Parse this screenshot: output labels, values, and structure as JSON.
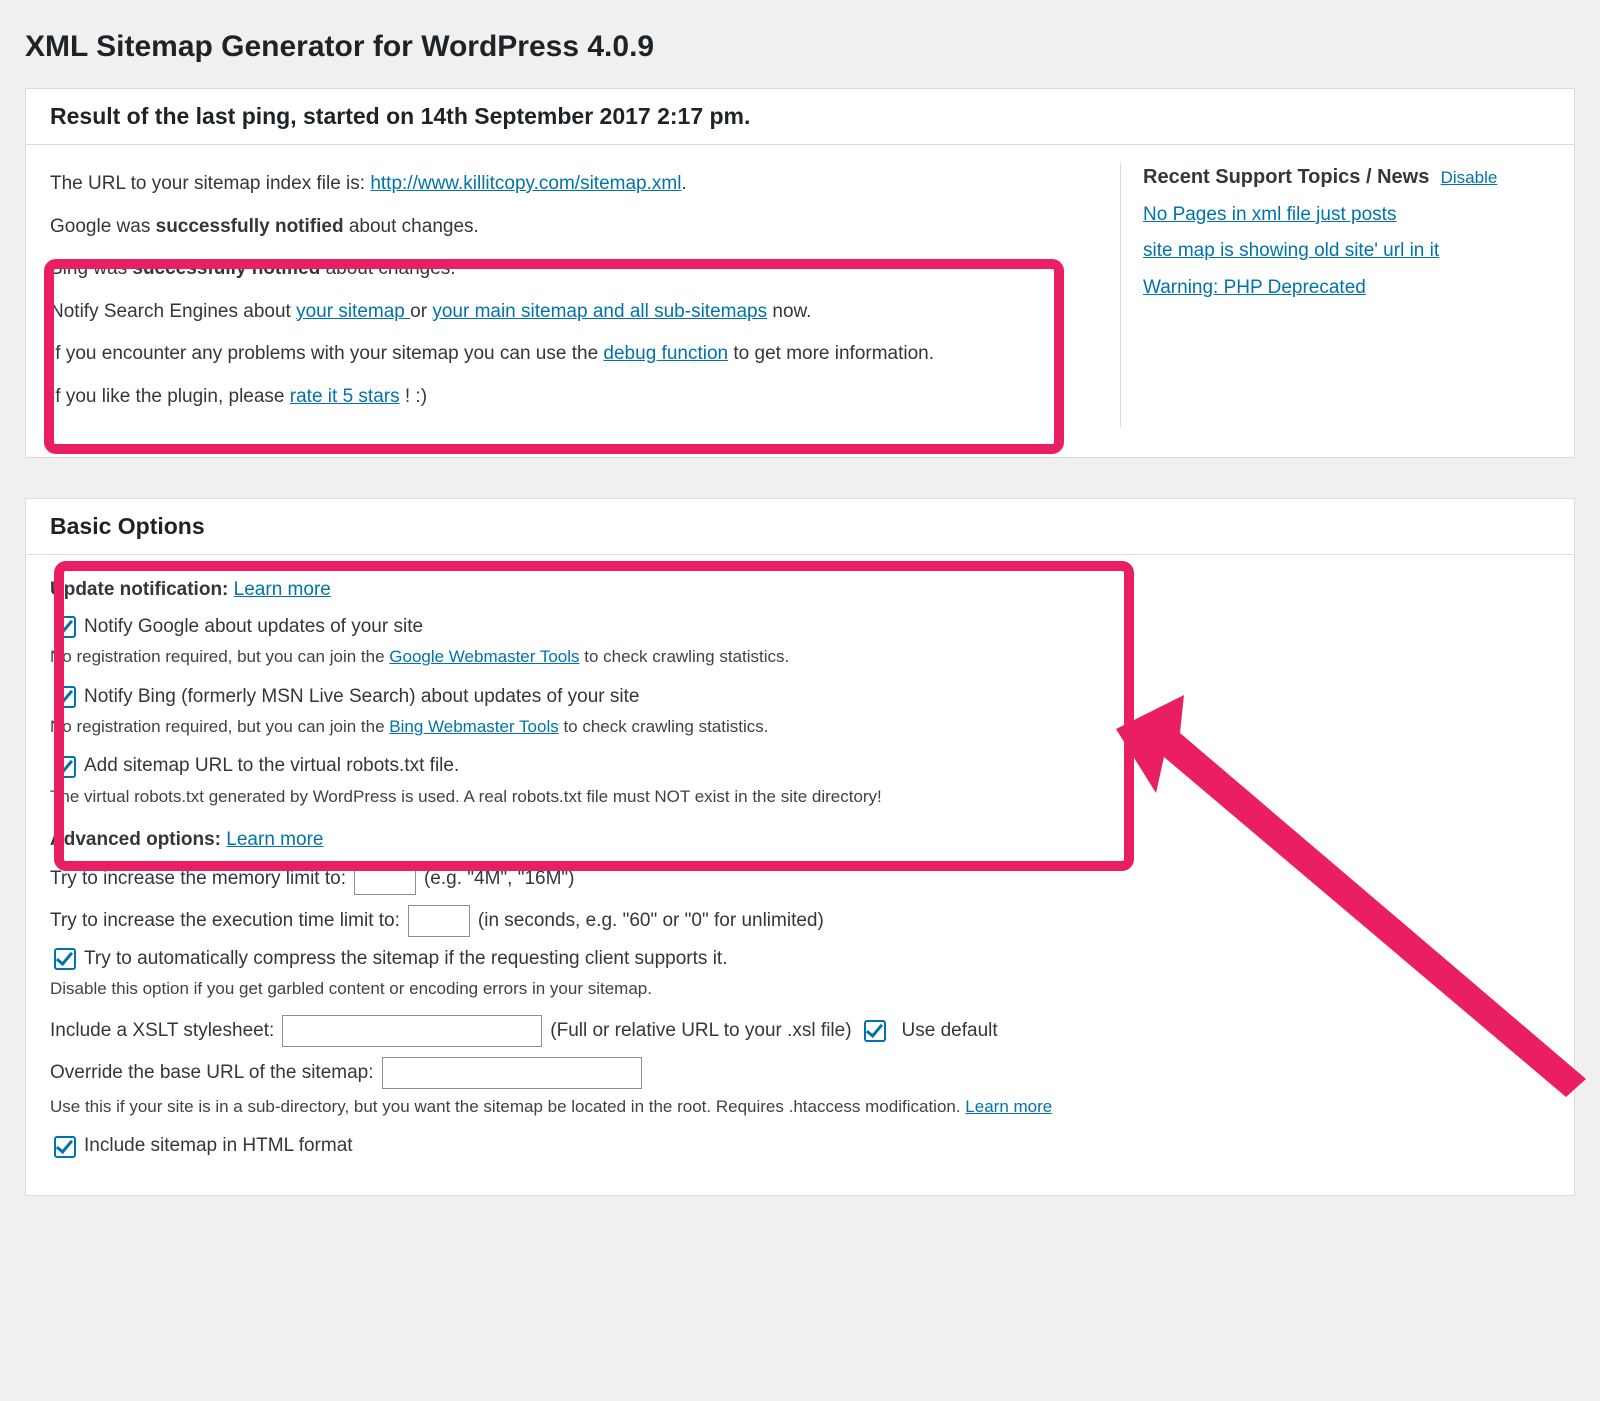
{
  "page": {
    "title": "XML Sitemap Generator for WordPress 4.0.9"
  },
  "ping": {
    "header": "Result of the last ping, started on 14th September 2017 2:17 pm.",
    "intro_prefix": "The URL to your sitemap index file is: ",
    "intro_link": "http://www.killitcopy.com/sitemap.xml",
    "intro_suffix": ".",
    "google_prefix": "Google was ",
    "google_bold": "successfully notified",
    "google_suffix": " about changes.",
    "bing_prefix": "Bing was ",
    "bing_bold": "successfully notified",
    "bing_suffix": " about changes.",
    "notify_prefix": "Notify Search Engines about ",
    "notify_link1": "your sitemap ",
    "notify_mid": "or ",
    "notify_link2": "your main sitemap and all sub-sitemaps",
    "notify_suffix": " now.",
    "debug_prefix": "If you encounter any problems with your sitemap you can use the ",
    "debug_link": "debug function",
    "debug_suffix": " to get more information.",
    "rate_prefix": "If you like the plugin, please ",
    "rate_link": "rate it 5 stars",
    "rate_suffix": "! :)"
  },
  "news": {
    "heading": "Recent Support Topics / News",
    "disable": "Disable",
    "topics": {
      "t1": "No Pages in xml file just posts",
      "t2": "site map is showing old site' url in it",
      "t3": "Warning: PHP Deprecated"
    }
  },
  "basic": {
    "header": "Basic Options",
    "update_heading": "Update notification:",
    "learn_more": "Learn more",
    "google_cb": "Notify Google about updates of your site",
    "google_desc_prefix": "No registration required, but you can join the ",
    "google_desc_link": "Google Webmaster Tools",
    "google_desc_suffix": " to check crawling statistics.",
    "bing_cb": "Notify Bing (formerly MSN Live Search) about updates of your site",
    "bing_desc_prefix": "No registration required, but you can join the ",
    "bing_desc_link": "Bing Webmaster Tools",
    "bing_desc_suffix": " to check crawling statistics.",
    "robots_cb": "Add sitemap URL to the virtual robots.txt file.",
    "robots_desc": "The virtual robots.txt generated by WordPress is used. A real robots.txt file must NOT exist in the site directory!",
    "adv_heading": "Advanced options:",
    "mem_label_pre": "Try to increase the memory limit to:",
    "mem_hint": "(e.g. \"4M\", \"16M\")",
    "exec_label_pre": "Try to increase the execution time limit to:",
    "exec_hint": "(in seconds, e.g. \"60\" or \"0\" for unlimited)",
    "compress_cb": "Try to automatically compress the sitemap if the requesting client supports it.",
    "compress_desc": "Disable this option if you get garbled content or encoding errors in your sitemap.",
    "xslt_label": "Include a XSLT stylesheet:",
    "xslt_hint": "(Full or relative URL to your .xsl file)",
    "xslt_default_cb": "Use default",
    "override_label": "Override the base URL of the sitemap:",
    "override_desc_prefix": "Use this if your site is in a sub-directory, but you want the sitemap be located in the root. Requires .htaccess modification. ",
    "override_learn": "Learn more",
    "html_cb": "Include sitemap in HTML format"
  }
}
